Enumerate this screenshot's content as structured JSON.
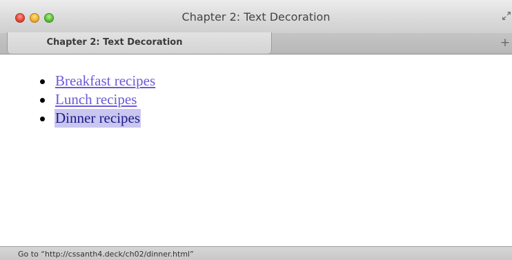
{
  "window": {
    "title": "Chapter 2: Text Decoration",
    "buttons": [
      "close",
      "minimize",
      "zoom"
    ],
    "fullscreen_icon": "fullscreen-arrows-icon"
  },
  "tabs": [
    {
      "label": "Chapter 2: Text Decoration",
      "active": true
    }
  ],
  "tabbar": {
    "new_tab_label": "+"
  },
  "content": {
    "links": [
      {
        "label": "Breakfast recipes",
        "state": "unvisited"
      },
      {
        "label": "Lunch recipes",
        "state": "unvisited"
      },
      {
        "label": "Dinner recipes",
        "state": "hover"
      }
    ]
  },
  "status": {
    "text": "Go to “http://cssanth4.deck/ch02/dinner.html”"
  },
  "colors": {
    "link": "#6b58d8",
    "link_hover_text": "#1c1a8a",
    "link_hover_bg": "#c9c6ef"
  }
}
